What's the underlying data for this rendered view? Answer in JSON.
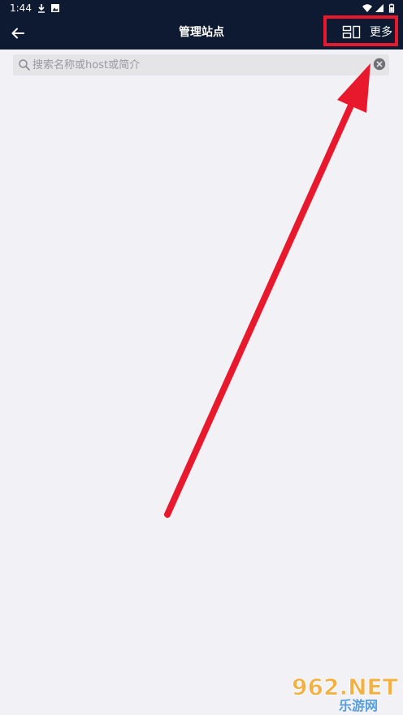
{
  "status_bar": {
    "time": "1:44",
    "icons": [
      "download-icon",
      "image-notification-icon",
      "wifi-icon",
      "signal-icon",
      "battery-icon"
    ]
  },
  "app_bar": {
    "title": "管理站点",
    "more_label": "更多",
    "back_icon": "arrow-left-icon",
    "layout_icon": "layout-toggle-icon"
  },
  "search": {
    "placeholder": "搜索名称或host或简介",
    "value": "",
    "icon": "search-icon",
    "clear_icon": "clear-icon"
  },
  "colors": {
    "header_background": "#0e1a31",
    "page_background": "#f2f1f6",
    "search_background": "#e5e5e8",
    "annotation_red": "#e8192c",
    "watermark_orange": "#f5a623"
  },
  "watermark": {
    "text": "962.NET",
    "subtext": "乐游网"
  }
}
